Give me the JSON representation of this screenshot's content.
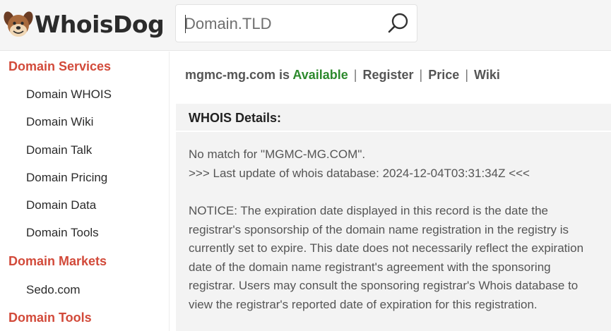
{
  "brand": {
    "name": "WhoisDog"
  },
  "search": {
    "placeholder": "Domain.TLD",
    "value": ""
  },
  "sidebar": {
    "sections": [
      {
        "heading": "Domain Services",
        "items": [
          "Domain WHOIS",
          "Domain Wiki",
          "Domain Talk",
          "Domain Pricing",
          "Domain Data",
          "Domain Tools"
        ]
      },
      {
        "heading": "Domain Markets",
        "items": [
          "Sedo.com"
        ]
      },
      {
        "heading": "Domain Tools",
        "items": []
      }
    ]
  },
  "result": {
    "domain": "mgmc-mg.com",
    "is_text": "is",
    "status": "Available",
    "links": [
      "Register",
      "Price",
      "Wiki"
    ],
    "separator": "|"
  },
  "whois": {
    "title": "WHOIS Details:",
    "lines": [
      "No match for \"MGMC-MG.COM\".",
      ">>> Last update of whois database: 2024-12-04T03:31:34Z <<<",
      "NOTICE: The expiration date displayed in this record is the date the",
      "registrar's sponsorship of the domain name registration in the registry is",
      "currently set to expire. This date does not necessarily reflect the expiration",
      "date of the domain name registrant's agreement with the sponsoring",
      "registrar. Users may consult the sponsoring registrar's Whois database to",
      "view the registrar's reported date of expiration for this registration."
    ]
  },
  "colors": {
    "section_heading": "#d24a3a",
    "domain_link": "#1a2fb0",
    "available": "#2d8a2d",
    "header_bg": "#f5f5f5",
    "panel_bg": "#f3f3f3"
  },
  "icons": {
    "logo": "dog-face-icon",
    "search": "search-icon"
  }
}
